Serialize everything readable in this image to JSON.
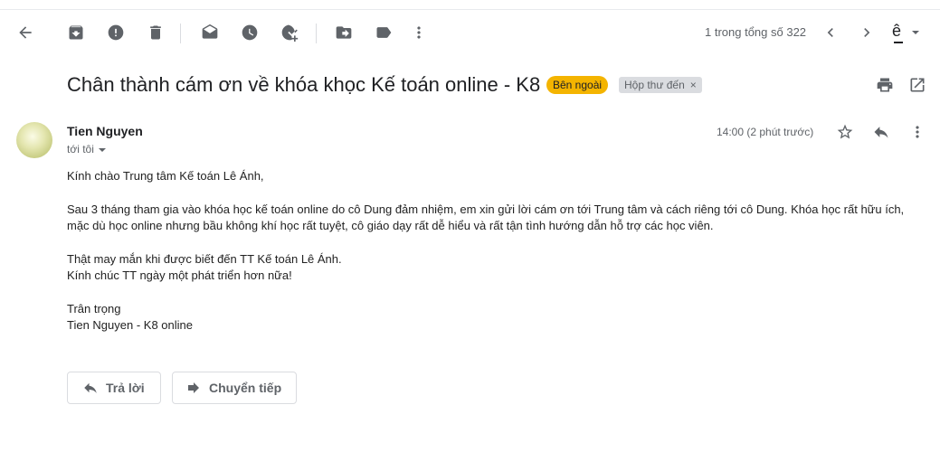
{
  "toolbar": {
    "pager_text": "1 trong tổng số 322",
    "lang_glyph": "ê",
    "icons": [
      "back-arrow-icon",
      "archive-icon",
      "report-spam-icon",
      "delete-icon",
      "mark-unread-icon",
      "snooze-icon",
      "add-to-tasks-icon",
      "move-to-icon",
      "label-icon",
      "more-vert-icon",
      "chevron-left-icon",
      "chevron-right-icon",
      "input-tools-icon"
    ]
  },
  "message": {
    "subject": "Chân thành cám ơn về khóa khọc Kế toán online - K8",
    "labels": {
      "external": "Bên ngoài",
      "inbox": "Hộp thư đến",
      "inbox_remove": "×"
    },
    "sender_name": "Tien Nguyen",
    "to_text": "tới tôi",
    "time_text": "14:00 (2 phút trước)",
    "body": {
      "greeting": "Kính chào Trung tâm Kế toán Lê Ánh,",
      "para1_line1": "Sau 3 tháng tham gia vào khóa học kế toán online do cô Dung đảm nhiệm, em xin gửi lời cám ơn tới Trung tâm và cách riêng tới cô Dung. Khóa học rất hữu ích,",
      "para1_line2": "mặc dù học online nhưng bầu không khí học rất tuyệt, cô giáo dạy rất dễ hiểu và rất tận tình hướng dẫn hỗ trợ các học viên.",
      "para2_line1": "Thật may mắn khi được biết đến TT Kế toán Lê Ánh.",
      "para2_line2": "Kính chúc TT ngày một phát triển hơn nữa!",
      "closing": "Trân trọng",
      "signature": "Tien Nguyen - K8 online"
    }
  },
  "actions": {
    "reply_label": "Trả lời",
    "forward_label": "Chuyển tiếp"
  },
  "colors": {
    "external_label_bg": "#f4b400",
    "inbox_label_bg": "#dadce0",
    "icon_gray": "#5f6368"
  }
}
